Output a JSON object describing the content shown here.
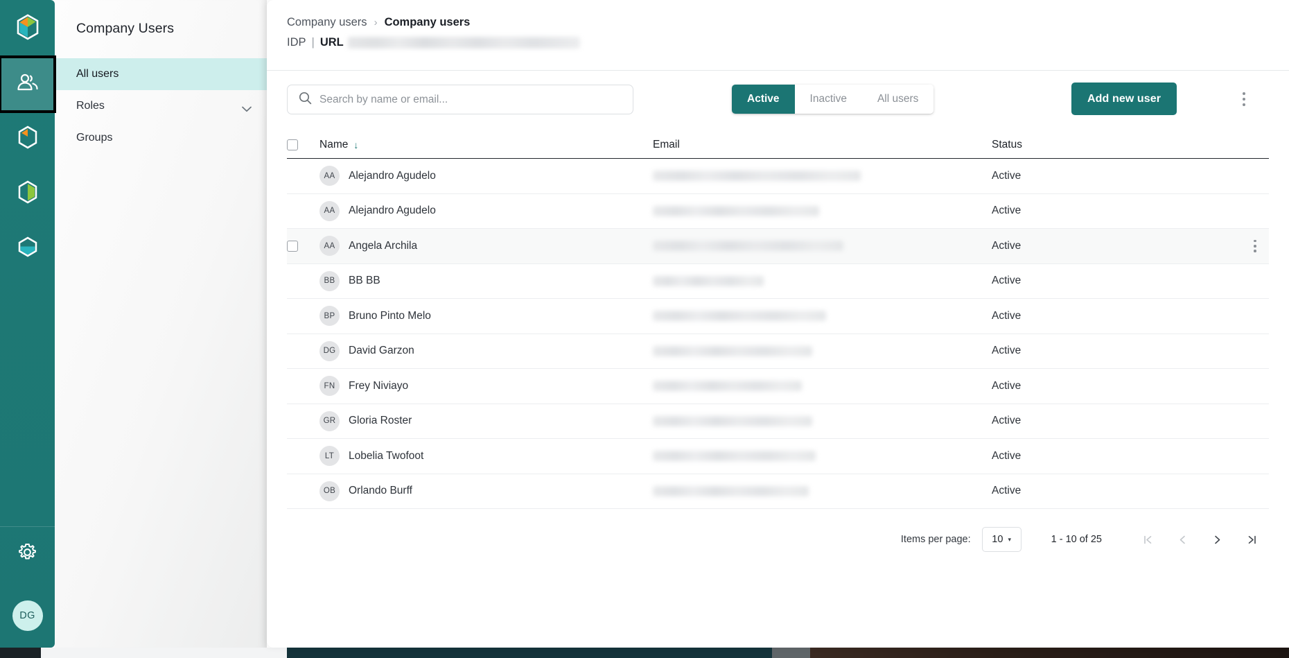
{
  "rail": {
    "items": [
      {
        "name": "brand-logo",
        "icon": "hex-logo-icon",
        "active": false
      },
      {
        "name": "users",
        "icon": "users-icon",
        "active": true
      },
      {
        "name": "module-orange",
        "icon": "hex-orange-icon",
        "active": false
      },
      {
        "name": "module-green",
        "icon": "hex-green-icon",
        "active": false
      },
      {
        "name": "module-teal",
        "icon": "hex-teal-icon",
        "active": false
      }
    ],
    "settings_icon": "gear-icon",
    "avatar_initials": "DG"
  },
  "sidebar": {
    "title": "Company Users",
    "items": [
      {
        "label": "All users",
        "active": true,
        "expandable": false
      },
      {
        "label": "Roles",
        "active": false,
        "expandable": true
      },
      {
        "label": "Groups",
        "active": false,
        "expandable": false
      }
    ]
  },
  "header": {
    "breadcrumb": [
      {
        "label": "Company users",
        "current": false
      },
      {
        "label": "Company users",
        "current": true
      }
    ],
    "separator": "›",
    "idp_label": "IDP",
    "divider": "|",
    "url_label": "URL",
    "url_value": ""
  },
  "toolbar": {
    "search_placeholder": "Search by name or email...",
    "search_value": "",
    "search_icon": "search-icon",
    "segments": [
      {
        "label": "Active",
        "selected": true
      },
      {
        "label": "Inactive",
        "selected": false
      },
      {
        "label": "All users",
        "selected": false
      }
    ],
    "add_label": "Add new user",
    "overflow_icon": "kebab-menu-icon"
  },
  "table": {
    "columns": [
      "Name",
      "Email",
      "Status"
    ],
    "sort_column": "Name",
    "sort_direction": "asc",
    "sort_icon": "↓",
    "rows": [
      {
        "initials": "AA",
        "name": "Alejandro Agudelo",
        "email": "",
        "status": "Active",
        "hovered": false
      },
      {
        "initials": "AA",
        "name": "Alejandro Agudelo",
        "email": "",
        "status": "Active",
        "hovered": false
      },
      {
        "initials": "AA",
        "name": "Angela Archila",
        "email": "",
        "status": "Active",
        "hovered": true
      },
      {
        "initials": "BB",
        "name": "BB BB",
        "email": "",
        "status": "Active",
        "hovered": false
      },
      {
        "initials": "BP",
        "name": "Bruno Pinto Melo",
        "email": "",
        "status": "Active",
        "hovered": false
      },
      {
        "initials": "DG",
        "name": "David Garzon",
        "email": "",
        "status": "Active",
        "hovered": false
      },
      {
        "initials": "FN",
        "name": "Frey Niviayo",
        "email": "",
        "status": "Active",
        "hovered": false
      },
      {
        "initials": "GR",
        "name": "Gloria Roster",
        "email": "",
        "status": "Active",
        "hovered": false
      },
      {
        "initials": "LT",
        "name": "Lobelia Twofoot",
        "email": "",
        "status": "Active",
        "hovered": false
      },
      {
        "initials": "OB",
        "name": "Orlando Burff",
        "email": "",
        "status": "Active",
        "hovered": false
      }
    ]
  },
  "paginator": {
    "items_per_page_label": "Items per page:",
    "items_per_page_value": "10",
    "caret": "▾",
    "range": "1 - 10 of 25",
    "first_icon": "❘‹",
    "prev_icon": "‹",
    "next_icon": "›",
    "last_icon": "›❘",
    "first_disabled": true,
    "prev_disabled": true,
    "next_disabled": false,
    "last_disabled": false
  },
  "colors": {
    "brand_teal": "#1b7573",
    "rail_teal": "#1d7874",
    "rail_active": "#3d8c89",
    "sidebar_active": "#cdeeec",
    "avatar_bg": "#cdf0ec",
    "text_dark": "#1b1f26"
  }
}
